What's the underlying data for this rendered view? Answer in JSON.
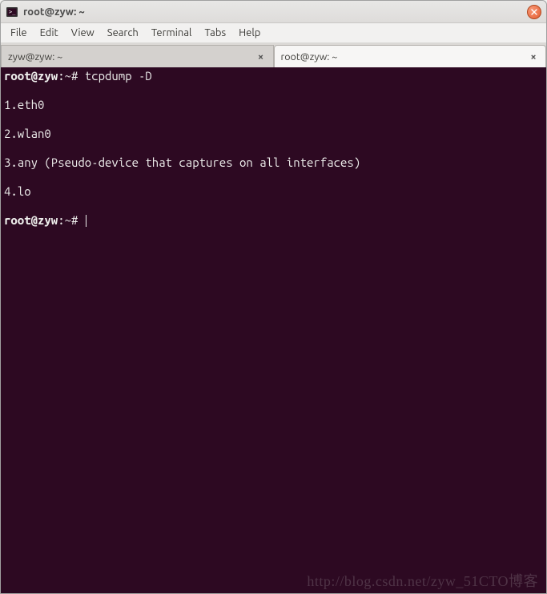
{
  "window": {
    "title": "root@zyw: ~"
  },
  "menu": {
    "file": "File",
    "edit": "Edit",
    "view": "View",
    "search": "Search",
    "terminal": "Terminal",
    "tabs": "Tabs",
    "help": "Help"
  },
  "tabs": [
    {
      "label": "zyw@zyw: ~",
      "active": false
    },
    {
      "label": "root@zyw: ~",
      "active": true
    }
  ],
  "terminal": {
    "prompt1_user": "root@zyw",
    "prompt1_path": ":~#",
    "command1": " tcpdump -D",
    "output": [
      "1.eth0",
      "2.wlan0",
      "3.any (Pseudo-device that captures on all interfaces)",
      "4.lo"
    ],
    "prompt2_user": "root@zyw",
    "prompt2_path": ":~#",
    "command2": " "
  },
  "watermark": "http://blog.csdn.net/zyw_51CTO博客"
}
